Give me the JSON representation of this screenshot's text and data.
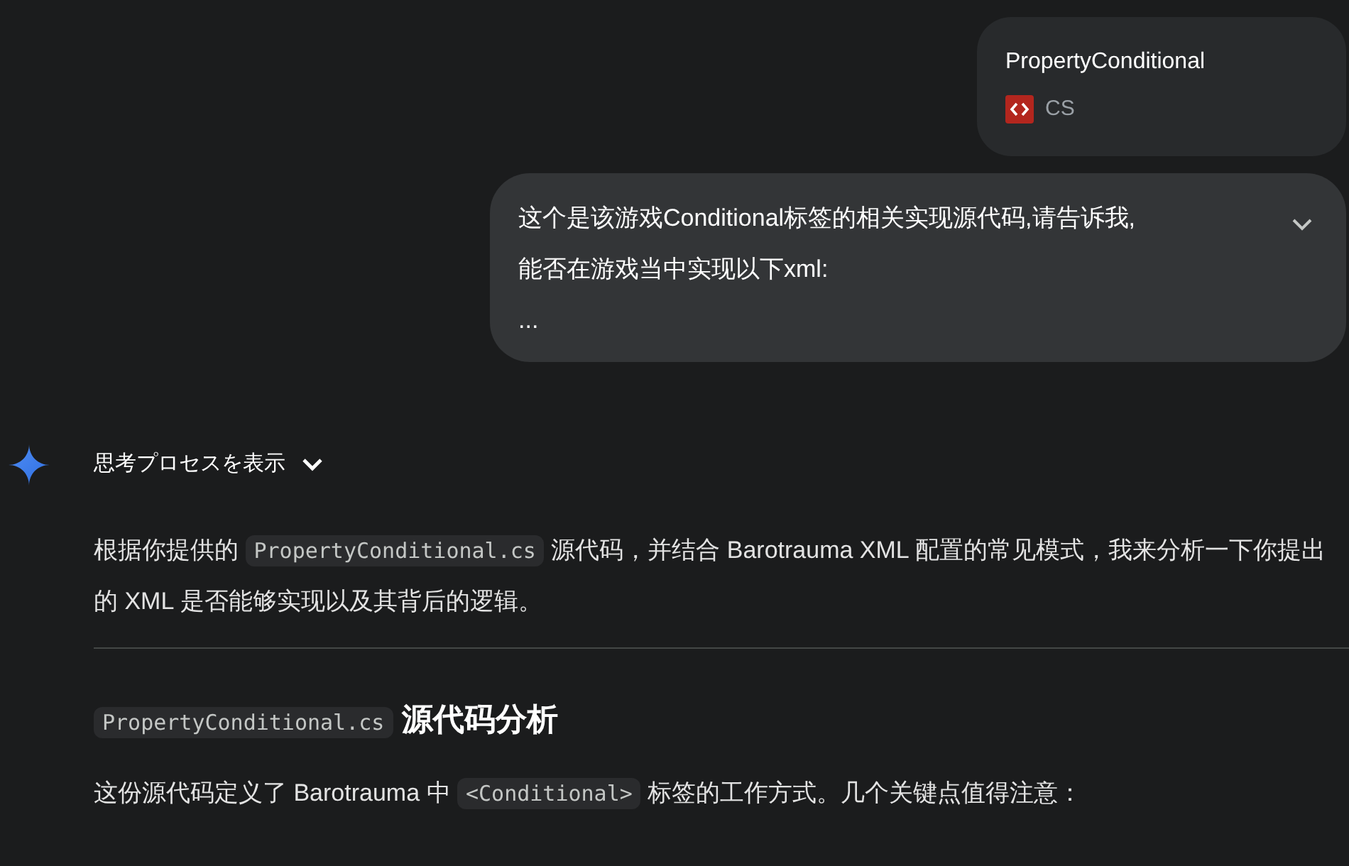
{
  "attachment": {
    "title": "PropertyConditional",
    "file_type": "CS"
  },
  "prompt": {
    "lines": [
      "这个是该游戏Conditional标签的相关实现源代码,请告诉我,",
      "能否在游戏当中实现以下xml:",
      "..."
    ],
    "expanded": false
  },
  "response": {
    "thinking_toggle": {
      "label": "思考プロセスを表示",
      "expanded": false
    },
    "blocks": [
      {
        "kind": "paragraph",
        "segments": [
          {
            "kind": "text",
            "text": "根据你提供的 "
          },
          {
            "kind": "code",
            "text": "PropertyConditional.cs"
          },
          {
            "kind": "text",
            "text": " 源代码，并结合 Barotrauma XML 配置的常见模式，我来分析一下你提出的 XML 是否能够实现以及其背后的逻辑。"
          }
        ]
      },
      {
        "kind": "divider"
      },
      {
        "kind": "heading",
        "segments": [
          {
            "kind": "code",
            "text": "PropertyConditional.cs"
          },
          {
            "kind": "text",
            "text": " 源代码分析"
          }
        ]
      },
      {
        "kind": "paragraph",
        "segments": [
          {
            "kind": "text",
            "text": "这份源代码定义了 Barotrauma 中 "
          },
          {
            "kind": "code",
            "text": "<Conditional>"
          },
          {
            "kind": "text",
            "text": " 标签的工作方式。几个关键点值得注意："
          }
        ]
      }
    ]
  }
}
